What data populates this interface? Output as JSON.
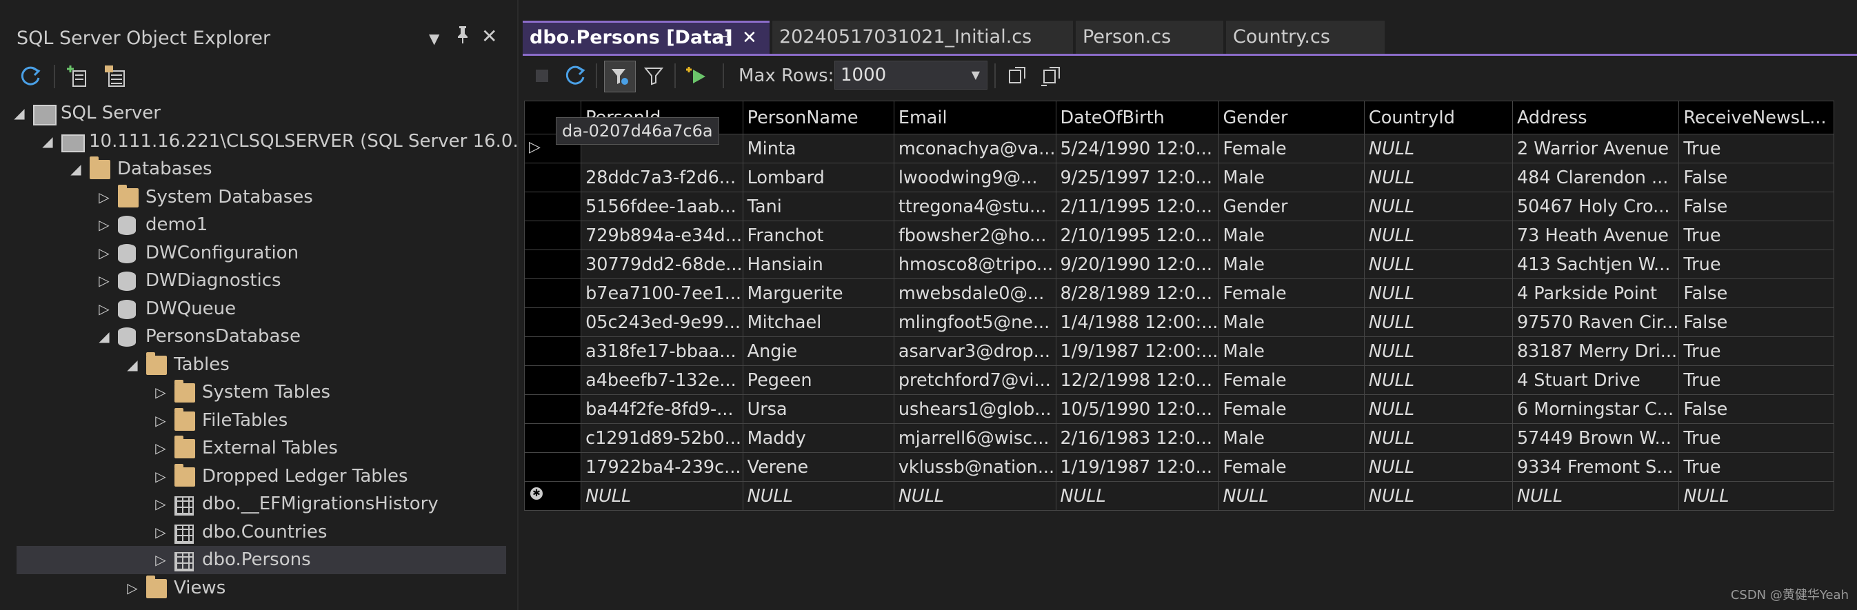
{
  "explorer": {
    "title": "SQL Server Object Explorer",
    "tree": [
      {
        "label": "SQL Server",
        "level": 0,
        "expanded": true,
        "icon": "servers"
      },
      {
        "label": "10.111.16.221\\CLSQLSERVER (SQL Server 16.0.",
        "level": 1,
        "expanded": true,
        "icon": "server"
      },
      {
        "label": "Databases",
        "level": 2,
        "expanded": true,
        "icon": "folder-open"
      },
      {
        "label": "System Databases",
        "level": 3,
        "expanded": false,
        "icon": "folder"
      },
      {
        "label": "demo1",
        "level": 3,
        "expanded": false,
        "icon": "database"
      },
      {
        "label": "DWConfiguration",
        "level": 3,
        "expanded": false,
        "icon": "database"
      },
      {
        "label": "DWDiagnostics",
        "level": 3,
        "expanded": false,
        "icon": "database"
      },
      {
        "label": "DWQueue",
        "level": 3,
        "expanded": false,
        "icon": "database"
      },
      {
        "label": "PersonsDatabase",
        "level": 3,
        "expanded": true,
        "icon": "database"
      },
      {
        "label": "Tables",
        "level": 4,
        "expanded": true,
        "icon": "folder-open"
      },
      {
        "label": "System Tables",
        "level": 5,
        "expanded": false,
        "icon": "folder"
      },
      {
        "label": "FileTables",
        "level": 5,
        "expanded": false,
        "icon": "folder"
      },
      {
        "label": "External Tables",
        "level": 5,
        "expanded": false,
        "icon": "folder"
      },
      {
        "label": "Dropped Ledger Tables",
        "level": 5,
        "expanded": false,
        "icon": "folder"
      },
      {
        "label": "dbo.__EFMigrationsHistory",
        "level": 5,
        "expanded": false,
        "icon": "table"
      },
      {
        "label": "dbo.Countries",
        "level": 5,
        "expanded": false,
        "icon": "table"
      },
      {
        "label": "dbo.Persons",
        "level": 5,
        "expanded": false,
        "icon": "table",
        "selected": true
      },
      {
        "label": "Views",
        "level": 4,
        "expanded": false,
        "icon": "folder"
      }
    ]
  },
  "tabs": [
    {
      "label": "dbo.Persons [Data]",
      "active": true
    },
    {
      "label": "20240517031021_Initial.cs"
    },
    {
      "label": "Person.cs"
    },
    {
      "label": "Country.cs"
    }
  ],
  "toolbar": {
    "max_rows_label": "Max Rows:",
    "max_rows_value": "1000"
  },
  "grid": {
    "columns": [
      "PersonId",
      "PersonName",
      "Email",
      "DateOfBirth",
      "Gender",
      "CountryId",
      "Address",
      "ReceiveNewsL..."
    ],
    "tooltip": "da-0207d46a7c6a",
    "rows": [
      [
        "",
        "Minta",
        "mconachya@va...",
        "5/24/1990 12:0...",
        "Female",
        "NULL",
        "2 Warrior Avenue",
        "True"
      ],
      [
        "28ddc7a3-f2d6...",
        "Lombard",
        "lwoodwing9@...",
        "9/25/1997 12:0...",
        "Male",
        "NULL",
        "484 Clarendon ...",
        "False"
      ],
      [
        "5156fdee-1aab...",
        "Tani",
        "ttregona4@stu...",
        "2/11/1995 12:0...",
        "Gender",
        "NULL",
        "50467 Holy Cro...",
        "False"
      ],
      [
        "729b894a-e34d...",
        "Franchot",
        "fbowsher2@ho...",
        "2/10/1995 12:0...",
        "Male",
        "NULL",
        "73 Heath Avenue",
        "True"
      ],
      [
        "30779dd2-68de...",
        "Hansiain",
        "hmosco8@tripo...",
        "9/20/1990 12:0...",
        "Male",
        "NULL",
        "413 Sachtjen W...",
        "True"
      ],
      [
        "b7ea7100-7ee1...",
        "Marguerite",
        "mwebsdale0@...",
        "8/28/1989 12:0...",
        "Female",
        "NULL",
        "4 Parkside Point",
        "False"
      ],
      [
        "05c243ed-9e99...",
        "Mitchael",
        "mlingfoot5@ne...",
        "1/4/1988 12:00:...",
        "Male",
        "NULL",
        "97570 Raven Cir...",
        "False"
      ],
      [
        "a318fe17-bbaa...",
        "Angie",
        "asarvar3@drop...",
        "1/9/1987 12:00:...",
        "Male",
        "NULL",
        "83187 Merry Dri...",
        "True"
      ],
      [
        "a4beefb7-132e...",
        "Pegeen",
        "pretchford7@vi...",
        "12/2/1998 12:0...",
        "Female",
        "NULL",
        "4 Stuart Drive",
        "True"
      ],
      [
        "ba44f2fe-8fd9-...",
        "Ursa",
        "ushears1@glob...",
        "10/5/1990 12:0...",
        "Female",
        "NULL",
        "6 Morningstar C...",
        "False"
      ],
      [
        "c1291d89-52b0...",
        "Maddy",
        "mjarrell6@wisc...",
        "2/16/1983 12:0...",
        "Male",
        "NULL",
        "57449 Brown W...",
        "True"
      ],
      [
        "17922ba4-239c...",
        "Verene",
        "vklussb@nation...",
        "1/19/1987 12:0...",
        "Female",
        "NULL",
        "9334 Fremont S...",
        "True"
      ]
    ],
    "new_row": [
      "NULL",
      "NULL",
      "NULL",
      "NULL",
      "NULL",
      "NULL",
      "NULL",
      "NULL"
    ]
  },
  "watermark": "CSDN @黄健华Yeah"
}
